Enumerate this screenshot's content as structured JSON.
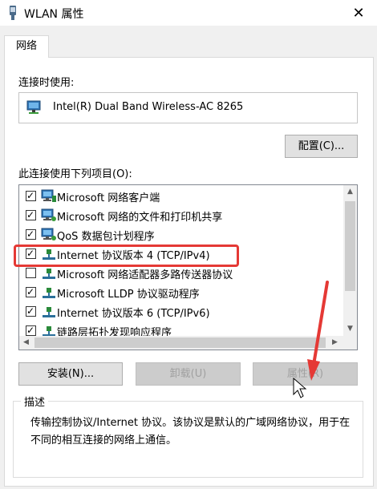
{
  "window": {
    "title": "WLAN 属性",
    "close_glyph": "✕"
  },
  "tabs": [
    {
      "label": "网络",
      "selected": true
    }
  ],
  "connect_using": {
    "label": "连接时使用:",
    "adapter_name": "Intel(R) Dual Band Wireless-AC 8265",
    "adapter_icon": "network-adapter-icon"
  },
  "buttons": {
    "configure": "配置(C)...",
    "install": "安装(N)...",
    "uninstall": "卸载(U)",
    "properties": "属性(R)"
  },
  "items_label": "此连接使用下列项目(O):",
  "items": [
    {
      "label": "Microsoft 网络客户端",
      "checked": true,
      "icon": "network-client-icon"
    },
    {
      "label": "Microsoft 网络的文件和打印机共享",
      "checked": true,
      "icon": "network-service-icon"
    },
    {
      "label": "QoS 数据包计划程序",
      "checked": true,
      "icon": "network-service-icon"
    },
    {
      "label": "Internet 协议版本 4 (TCP/IPv4)",
      "checked": true,
      "icon": "protocol-icon",
      "highlighted": true
    },
    {
      "label": "Microsoft 网络适配器多路传送器协议",
      "checked": false,
      "icon": "protocol-icon"
    },
    {
      "label": "Microsoft LLDP 协议驱动程序",
      "checked": true,
      "icon": "protocol-icon"
    },
    {
      "label": "Internet 协议版本 6 (TCP/IPv6)",
      "checked": true,
      "icon": "protocol-icon"
    },
    {
      "label": "链路层拓扑发现响应程序",
      "checked": true,
      "icon": "protocol-icon"
    }
  ],
  "description": {
    "title": "描述",
    "text": "传输控制协议/Internet 协议。该协议是默认的广域网络协议，用于在不同的相互连接的网络上通信。"
  },
  "colors": {
    "annotation_red": "#e53935",
    "button_face": "#e1e1e1",
    "window_bg": "#f0f0f0"
  }
}
